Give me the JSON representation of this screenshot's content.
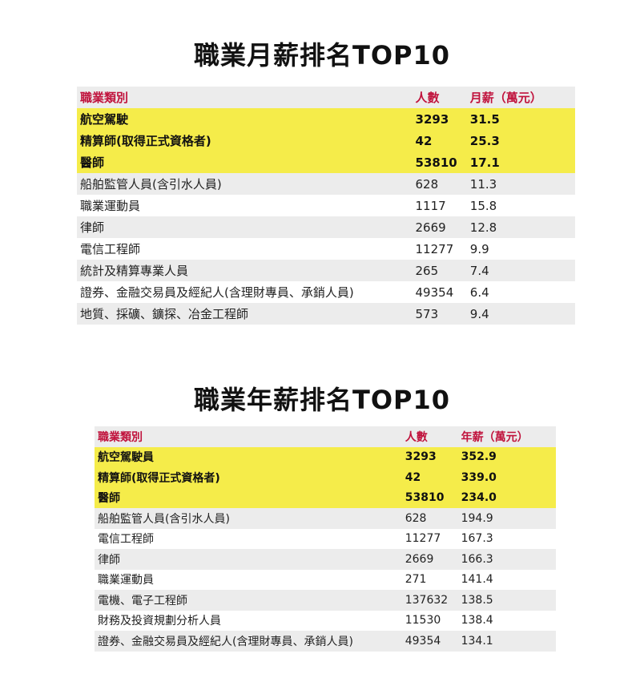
{
  "monthly": {
    "title": "職業月薪排名TOP10",
    "headers": [
      "職業類別",
      "人數",
      "月薪（萬元）"
    ],
    "rows": [
      {
        "job": "航空駕駛",
        "count": "3293",
        "salary": "31.5"
      },
      {
        "job": "精算師(取得正式資格者)",
        "count": "42",
        "salary": "25.3"
      },
      {
        "job": "醫師",
        "count": "53810",
        "salary": "17.1"
      },
      {
        "job": "船舶監管人員(含引水人員)",
        "count": "628",
        "salary": "11.3"
      },
      {
        "job": "職業運動員",
        "count": "1117",
        "salary": "15.8"
      },
      {
        "job": "律師",
        "count": "2669",
        "salary": "12.8"
      },
      {
        "job": "電信工程師",
        "count": "11277",
        "salary": "9.9"
      },
      {
        "job": "統計及精算專業人員",
        "count": "265",
        "salary": "7.4"
      },
      {
        "job": "證券、金融交易員及經紀人(含理財專員、承銷人員)",
        "count": "49354",
        "salary": "6.4"
      },
      {
        "job": "地質、採礦、鑛探、冶金工程師",
        "count": "573",
        "salary": "9.4"
      }
    ]
  },
  "yearly": {
    "title": "職業年薪排名TOP10",
    "headers": [
      "職業類別",
      "人數",
      "年薪（萬元）"
    ],
    "rows": [
      {
        "job": "航空駕駛員",
        "count": "3293",
        "salary": "352.9"
      },
      {
        "job": "精算師(取得正式資格者)",
        "count": "42",
        "salary": "339.0"
      },
      {
        "job": "醫師",
        "count": "53810",
        "salary": "234.0"
      },
      {
        "job": "船舶監管人員(含引水人員)",
        "count": "628",
        "salary": "194.9"
      },
      {
        "job": "電信工程師",
        "count": "11277",
        "salary": "167.3"
      },
      {
        "job": "律師",
        "count": "2669",
        "salary": "166.3"
      },
      {
        "job": "職業運動員",
        "count": "271",
        "salary": "141.4"
      },
      {
        "job": "電機、電子工程師",
        "count": "137632",
        "salary": "138.5"
      },
      {
        "job": "財務及投資規劃分析人員",
        "count": "11530",
        "salary": "138.4"
      },
      {
        "job": "證券、金融交易員及經紀人(含理財專員、承銷人員)",
        "count": "49354",
        "salary": "134.1"
      }
    ]
  },
  "colors": {
    "header_text": "#c0123c",
    "highlight": "#f5ec4a",
    "stripe": "#ececec"
  }
}
